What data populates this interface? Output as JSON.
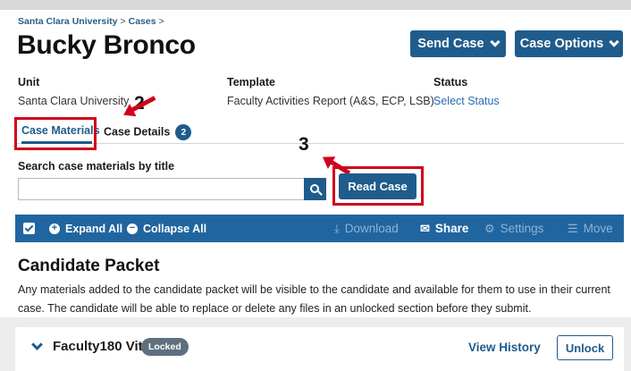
{
  "breadcrumb": {
    "root": "Santa Clara University",
    "separator": ">",
    "current": "Cases"
  },
  "page_title": "Bucky Bronco",
  "header_buttons": {
    "send_case": "Send Case",
    "case_options": "Case Options"
  },
  "info": {
    "unit_label": "Unit",
    "unit_value": "Santa Clara University",
    "template_label": "Template",
    "template_value": "Faculty Activities Report (A&S, ECP, LSB)",
    "status_label": "Status",
    "status_value": "Select Status"
  },
  "annotations": {
    "two": "2",
    "three": "3"
  },
  "tabs": {
    "materials": "Case Materials",
    "details": "Case Details",
    "details_count": "2"
  },
  "search": {
    "label": "Search case materials by title",
    "value": "",
    "placeholder": ""
  },
  "read_case": "Read Case",
  "toolbar": {
    "expand_all": "Expand All",
    "collapse_all": "Collapse All",
    "download": "Download",
    "share": "Share",
    "settings": "Settings",
    "move": "Move"
  },
  "packet": {
    "title": "Candidate Packet",
    "description": "Any materials added to the candidate packet will be visible to the candidate and available for them to use in their current case. The candidate will be able to replace or delete any files in an unlocked section before they submit."
  },
  "section": {
    "title": "Faculty180 Vita",
    "status_pill": "Locked",
    "view_history": "View History",
    "unlock": "Unlock"
  },
  "colors": {
    "primary": "#1f5c8c",
    "toolbar": "#2065a0",
    "annotation_red": "#d0021b",
    "link": "#2b6cb0"
  },
  "icons": [
    "chevron-down-icon",
    "search-icon",
    "checkbox-icon",
    "plus-circle-icon",
    "minus-circle-icon",
    "download-icon",
    "mail-icon",
    "gear-icon",
    "move-icon"
  ]
}
